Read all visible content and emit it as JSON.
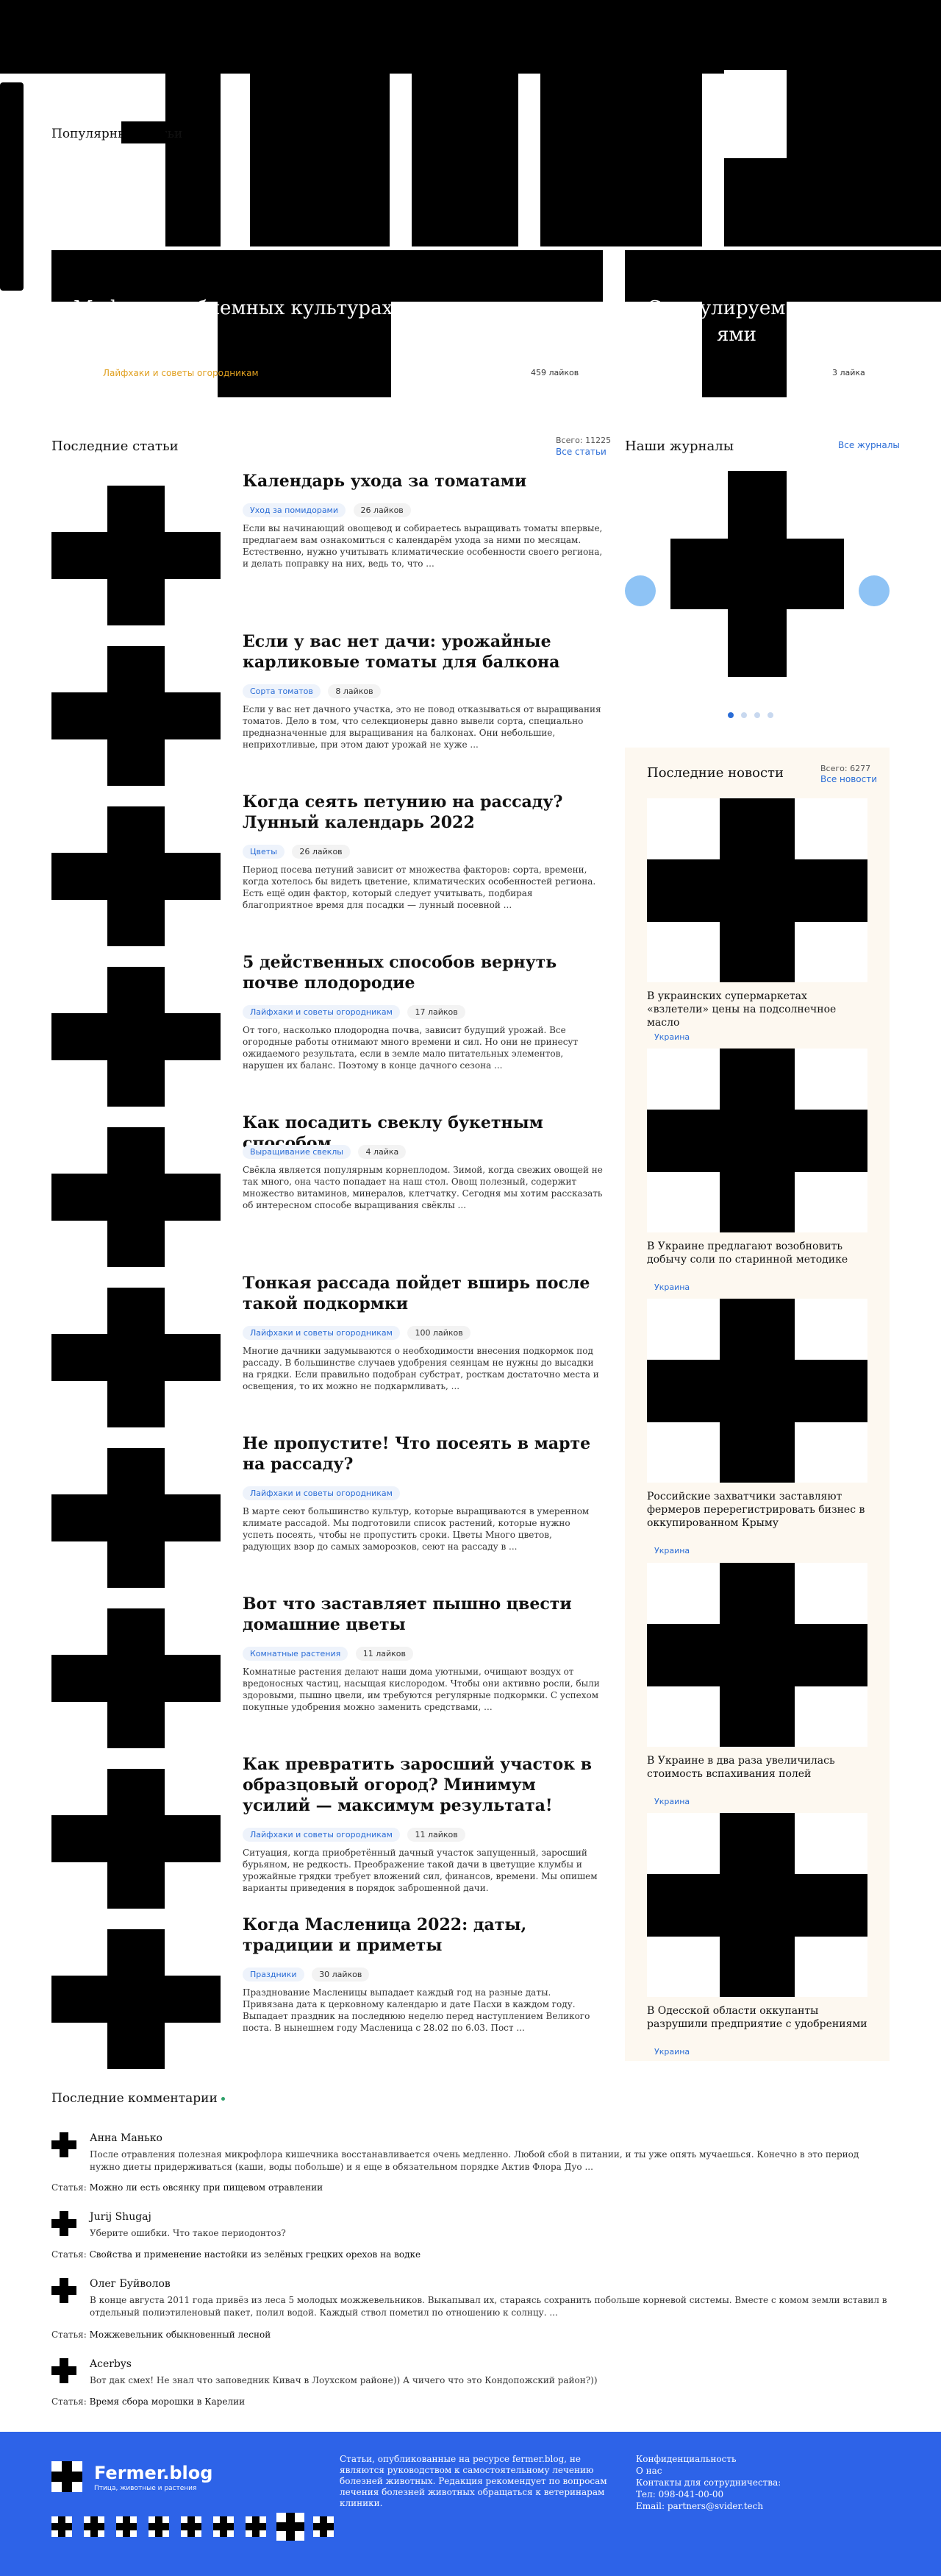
{
  "popular": {
    "title": "Популярные статьи",
    "cards": [
      {
        "title": "Мифы о проблемных культурах, которые давно пора",
        "category": "Лайфхаки и советы огородникам",
        "likes": "459 лайков"
      },
      {
        "title": "Стимулируем с",
        "subtitle": "ями",
        "likes": "3 лайка"
      }
    ]
  },
  "latest": {
    "title": "Последние статьи",
    "total": "Всего: 11225",
    "all_link": "Все статьи",
    "items": [
      {
        "title": "Календарь ухода за томатами",
        "category": "Уход за помидорами",
        "likes": "26 лайков",
        "excerpt": "Если вы начинающий овощевод и собираетесь выращивать томаты впервые, предлагаем вам ознакомиться с календарём ухода за ними по месяцам. Естественно, нужно учитывать климатические особенности своего региона, и делать поправку на них, ведь то, что ..."
      },
      {
        "title": "Если у вас нет дачи: урожайные карликовые томаты для балкона",
        "category": "Сорта томатов",
        "likes": "8 лайков",
        "excerpt": "Если у вас нет дачного участка, это не повод отказываться от выращивания томатов. Дело в том, что селекционеры давно вывели сорта, специально предназначенные для выращивания на балконах. Они небольшие, неприхотливые, при этом дают урожай не хуже ..."
      },
      {
        "title": "Когда сеять петунию на рассаду? Лунный календарь 2022",
        "category": "Цветы",
        "likes": "26 лайков",
        "excerpt": "Период посева петуний зависит от множества факторов: сорта, времени, когда хотелось бы видеть цветение, климатических особенностей региона. Есть ещё один фактор, который следует учитывать, подбирая благоприятное время для посадки — лунный посевной ..."
      },
      {
        "title": "5 действенных способов вернуть почве плодородие",
        "category": "Лайфхаки и советы огородникам",
        "likes": "17 лайков",
        "excerpt": "От того, насколько плодородна почва, зависит будущий урожай. Все огородные работы отнимают много времени и сил. Но они не принесут ожидаемого результата, если в земле мало питательных элементов, нарушен их баланс. Поэтому в конце дачного сезона ..."
      },
      {
        "title": "Как посадить свеклу букетным способом",
        "category": "Выращивание свеклы",
        "likes": "4 лайка",
        "excerpt": "Свёкла является популярным корнеплодом. Зимой, когда свежих овощей не так много, она часто попадает на наш стол. Овощ полезный, содержит множество витаминов, минералов, клетчатку. Сегодня мы хотим рассказать об интересном способе выращивания свёклы ..."
      },
      {
        "title": "Тонкая рассада пойдет вширь после такой подкормки",
        "category": "Лайфхаки и советы огородникам",
        "likes": "100 лайков",
        "excerpt": "Многие дачники задумываются о необходимости внесения подкормок под рассаду. В большинстве случаев удобрения сеянцам не нужны до высадки на грядки. Если правильно подобран субстрат, росткам достаточно места и освещения, то их можно не подкармливать, ..."
      },
      {
        "title": "Не пропустите! Что посеять в марте на рассаду?",
        "category": "Лайфхаки и советы огородникам",
        "likes": "",
        "excerpt": "В марте сеют большинство культур, которые выращиваются в умеренном климате рассадой. Мы подготовили список растений, которые нужно успеть посеять, чтобы не пропустить сроки. Цветы Много цветов, радующих взор до самых заморозков, сеют на рассаду в ..."
      },
      {
        "title": "Вот что заставляет пышно цвести домашние цветы",
        "category": "Комнатные растения",
        "likes": "11 лайков",
        "excerpt": "Комнатные растения делают наши дома уютными, очищают воздух от вредоносных частиц, насыщая кислородом. Чтобы они активно росли, были здоровыми, пышно цвели, им требуются регулярные подкормки. С успехом покупные удобрения можно заменить средствами, ..."
      },
      {
        "title": "Как превратить заросший участок в образцовый огород? Минимум усилий — максимум результата!",
        "category": "Лайфхаки и советы огородникам",
        "likes": "11 лайков",
        "excerpt": "Ситуация, когда приобретённый дачный участок запущенный, заросший бурьяном, не редкость. Преображение такой дачи в цветущие клумбы и урожайные грядки требует вложений сил, финансов, времени. Мы опишем варианты приведения в порядок заброшенной дачи."
      },
      {
        "title": "Когда Масленица 2022: даты, традиции и приметы",
        "category": "Праздники",
        "likes": "30 лайков",
        "excerpt": "Празднование Масленицы выпадает каждый год на разные даты. Привязана дата к церковному календарю и дате Пасхи в каждом году. Выпадает праздник на последнюю неделю перед наступлением Великого поста. В нынешнем году Масленица с 28.02 по 6.03. Пост ..."
      }
    ]
  },
  "journals": {
    "title": "Наши журналы",
    "all_link": "Все журналы"
  },
  "news": {
    "title": "Последние новости",
    "total": "Всего: 6277",
    "all_link": "Все новости",
    "items": [
      {
        "title": "В украинских супермаркетах «взлетели» цены на подсолнечное масло",
        "tag": "Украина"
      },
      {
        "title": "В Украине предлагают возобновить добычу соли по старинной методике",
        "tag": "Украина"
      },
      {
        "title": "Российские захватчики заставляют фермеров перерегистрировать бизнес в оккупированном Крыму",
        "tag": "Украина"
      },
      {
        "title": "В Украине в два раза увеличилась стоимость вспахивания полей",
        "tag": "Украина"
      },
      {
        "title": "В Одесской области оккупанты разрушили предприятие с удобрениями",
        "tag": "Украина"
      }
    ]
  },
  "comments": {
    "title": "Последние комментарии",
    "article_prefix": "Статья:",
    "items": [
      {
        "author": "Анна Манько",
        "text": "После отравления полезная микрофлора кишечника восстанавливается очень медленно. Любой сбой в питании, и ты уже опять мучаешься. Конечно в это период нужно диеты придерживаться (каши, воды побольше) и я еще в обязательном порядке Актив Флора Дуо ...",
        "article": "Можно ли есть овсянку при пищевом отравлении"
      },
      {
        "author": "Jurij Shugaj",
        "text": "Уберите ошибки. Что такое периодонтоз?",
        "article": "Свойства и применение настойки из зелёных грецких орехов на водке"
      },
      {
        "author": "Олег Буйволов",
        "text": "В конце августа 2011 года привёз из леса 5 молодых можжевельников. Выкапывал их, стараясь сохранить побольше корневой системы. Вместе с комом земли вставил в отдельный полиэтиленовый пакет, полил водой. Каждый ствол пометил по отношению к солнцу. ...",
        "article": "Можжевельник обыкновенный лесной"
      },
      {
        "author": "Acerbys",
        "text": "Вот дак смех! Не знал что заповедник Кивач в Лоухском районе)) А чичего что это Кондопожский район?))",
        "article": "Время сбора морошки в Карелии"
      }
    ]
  },
  "footer": {
    "logo_text": "Fermer.blog",
    "logo_sub": "Птица, животные и растения",
    "disclaimer": "Статьи, опубликованные на ресурсе fermer.blog, не являются руководством к самостоятельному лечению болезней животных. Редакция рекомендует по вопросам лечения болезней животных обращаться к ветеринарам клиники.",
    "links": [
      "Конфиденциальность",
      "О нас",
      "Контакты для сотрудничества:"
    ],
    "phone": "Тел: 098-041-00-00",
    "email": "Email: partners@svider.tech",
    "colors": {
      "footer_bg": "#2d63e8",
      "accent": "#2a6cd6",
      "news_bg": "#fdf8f0"
    }
  }
}
